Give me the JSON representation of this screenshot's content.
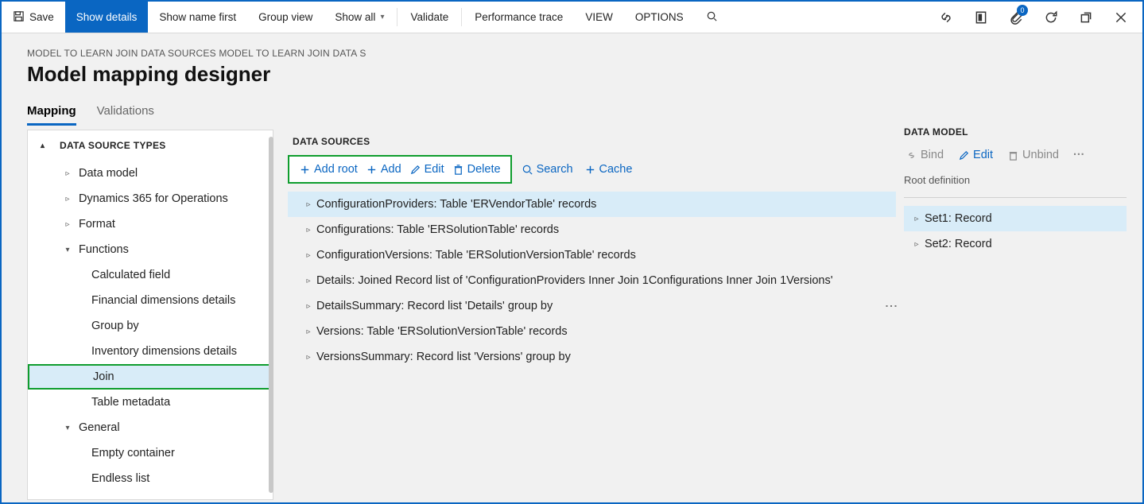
{
  "cmdbar": {
    "save": "Save",
    "show_details": "Show details",
    "show_name_first": "Show name first",
    "group_view": "Group view",
    "show_all": "Show all",
    "validate": "Validate",
    "perf_trace": "Performance trace",
    "view": "VIEW",
    "options": "OPTIONS",
    "badge_count": "0"
  },
  "breadcrumb": "MODEL TO LEARN JOIN DATA SOURCES MODEL TO LEARN JOIN DATA S",
  "page_title": "Model mapping designer",
  "tabs": {
    "mapping": "Mapping",
    "validations": "Validations"
  },
  "left": {
    "header": "DATA SOURCE TYPES",
    "data_model": "Data model",
    "d365": "Dynamics 365 for Operations",
    "format": "Format",
    "functions": "Functions",
    "calc_field": "Calculated field",
    "fin_dim": "Financial dimensions details",
    "group_by": "Group by",
    "inv_dim": "Inventory dimensions details",
    "join": "Join",
    "table_meta": "Table metadata",
    "general": "General",
    "empty_cont": "Empty container",
    "endless": "Endless list"
  },
  "mid": {
    "header": "DATA SOURCES",
    "add_root": "Add root",
    "add": "Add",
    "edit": "Edit",
    "delete": "Delete",
    "search": "Search",
    "cache": "Cache",
    "rows": [
      "ConfigurationProviders: Table 'ERVendorTable' records",
      "Configurations: Table 'ERSolutionTable' records",
      "ConfigurationVersions: Table 'ERSolutionVersionTable' records",
      "Details: Joined Record list of 'ConfigurationProviders Inner Join 1Configurations Inner Join 1Versions'",
      "DetailsSummary: Record list 'Details' group by",
      "Versions: Table 'ERSolutionVersionTable' records",
      "VersionsSummary: Record list 'Versions' group by"
    ]
  },
  "right": {
    "header": "DATA MODEL",
    "bind": "Bind",
    "edit": "Edit",
    "unbind": "Unbind",
    "root_def": "Root definition",
    "rows": [
      "Set1: Record",
      "Set2: Record"
    ]
  }
}
